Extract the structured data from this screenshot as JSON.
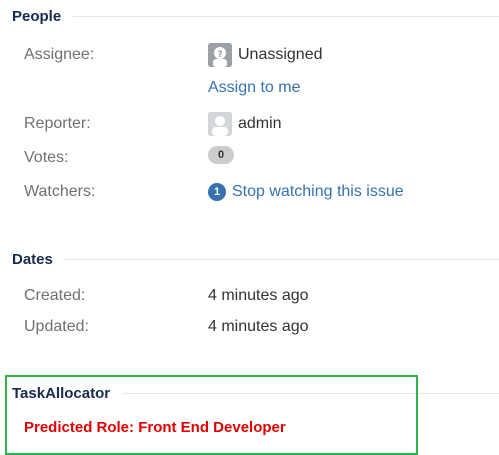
{
  "people": {
    "title": "People",
    "assignee": {
      "label": "Assignee:",
      "value": "Unassigned",
      "assign_link": "Assign to me"
    },
    "reporter": {
      "label": "Reporter:",
      "value": "admin"
    },
    "votes": {
      "label": "Votes:",
      "count": "0"
    },
    "watchers": {
      "label": "Watchers:",
      "count": "1",
      "action": "Stop watching this issue"
    }
  },
  "dates": {
    "title": "Dates",
    "created": {
      "label": "Created:",
      "value": "4 minutes ago"
    },
    "updated": {
      "label": "Updated:",
      "value": "4 minutes ago"
    }
  },
  "task_allocator": {
    "title": "TaskAllocator",
    "predicted_role": "Predicted Role: Front End Developer"
  },
  "colors": {
    "link": "#3572b0",
    "predicted_text": "#e00000",
    "highlight_border": "#2fb34a"
  }
}
